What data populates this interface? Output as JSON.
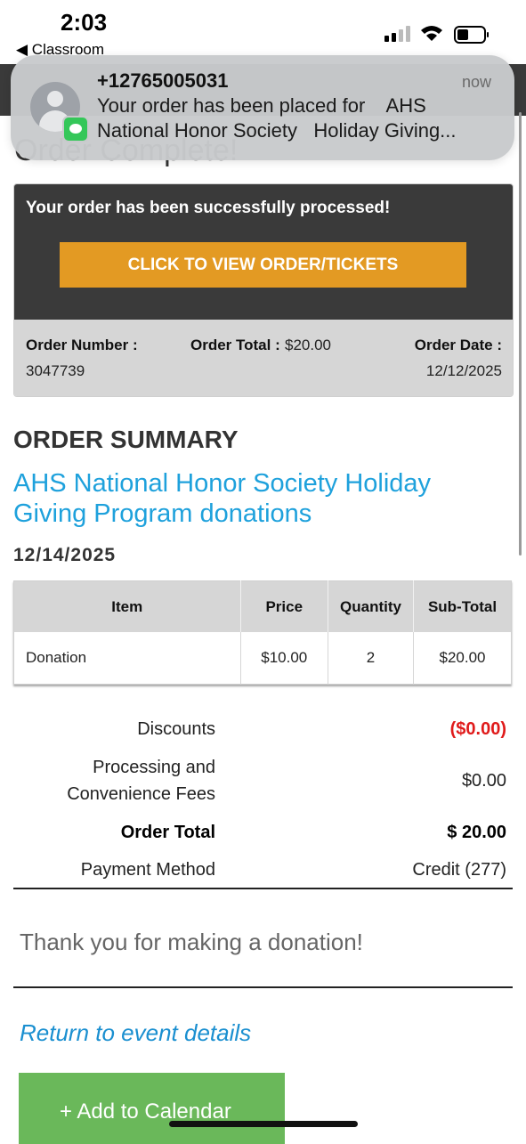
{
  "status_bar": {
    "time": "2:03",
    "back_app": "◀ Classroom"
  },
  "header": {
    "page_title_partial": "Order Complete!"
  },
  "notification": {
    "sender": "+12765005031",
    "time": "now",
    "line1": "Your order has been placed for    AHS",
    "line2": "National Honor Society   Holiday Giving..."
  },
  "order_box": {
    "message": "Your order has been successfully processed!",
    "view_button": "CLICK TO VIEW ORDER/TICKETS",
    "order_number_label": "Order Number :",
    "order_number": "3047739",
    "order_total_label": "Order Total :",
    "order_total": "$20.00",
    "order_date_label": "Order Date :",
    "order_date": "12/12/2025"
  },
  "summary": {
    "heading": "ORDER SUMMARY",
    "event_title": "AHS National Honor Society Holiday Giving Program donations",
    "event_date": "12/14/2025"
  },
  "table": {
    "headers": [
      "Item",
      "Price",
      "Quantity",
      "Sub-Total"
    ],
    "rows": [
      [
        "Donation",
        "$10.00",
        "2",
        "$20.00"
      ]
    ]
  },
  "totals": {
    "discounts_label": "Discounts",
    "discounts_value": "($0.00)",
    "fees_label_1": "Processing and",
    "fees_label_2": "Convenience Fees",
    "fees_value": "$0.00",
    "order_total_label": "Order Total",
    "order_total_value": "$ 20.00",
    "payment_label": "Payment Method",
    "payment_value": "Credit (277)"
  },
  "thanks": "Thank you for making a donation!",
  "return_link": "Return to event details",
  "calendar_button": "+ Add to Calendar",
  "colors": {
    "accent_orange": "#e39a23",
    "link_blue": "#1ea1dc",
    "green": "#6ab85a",
    "discount_red": "#e01b1b",
    "dark_panel": "#3a3a3a"
  }
}
